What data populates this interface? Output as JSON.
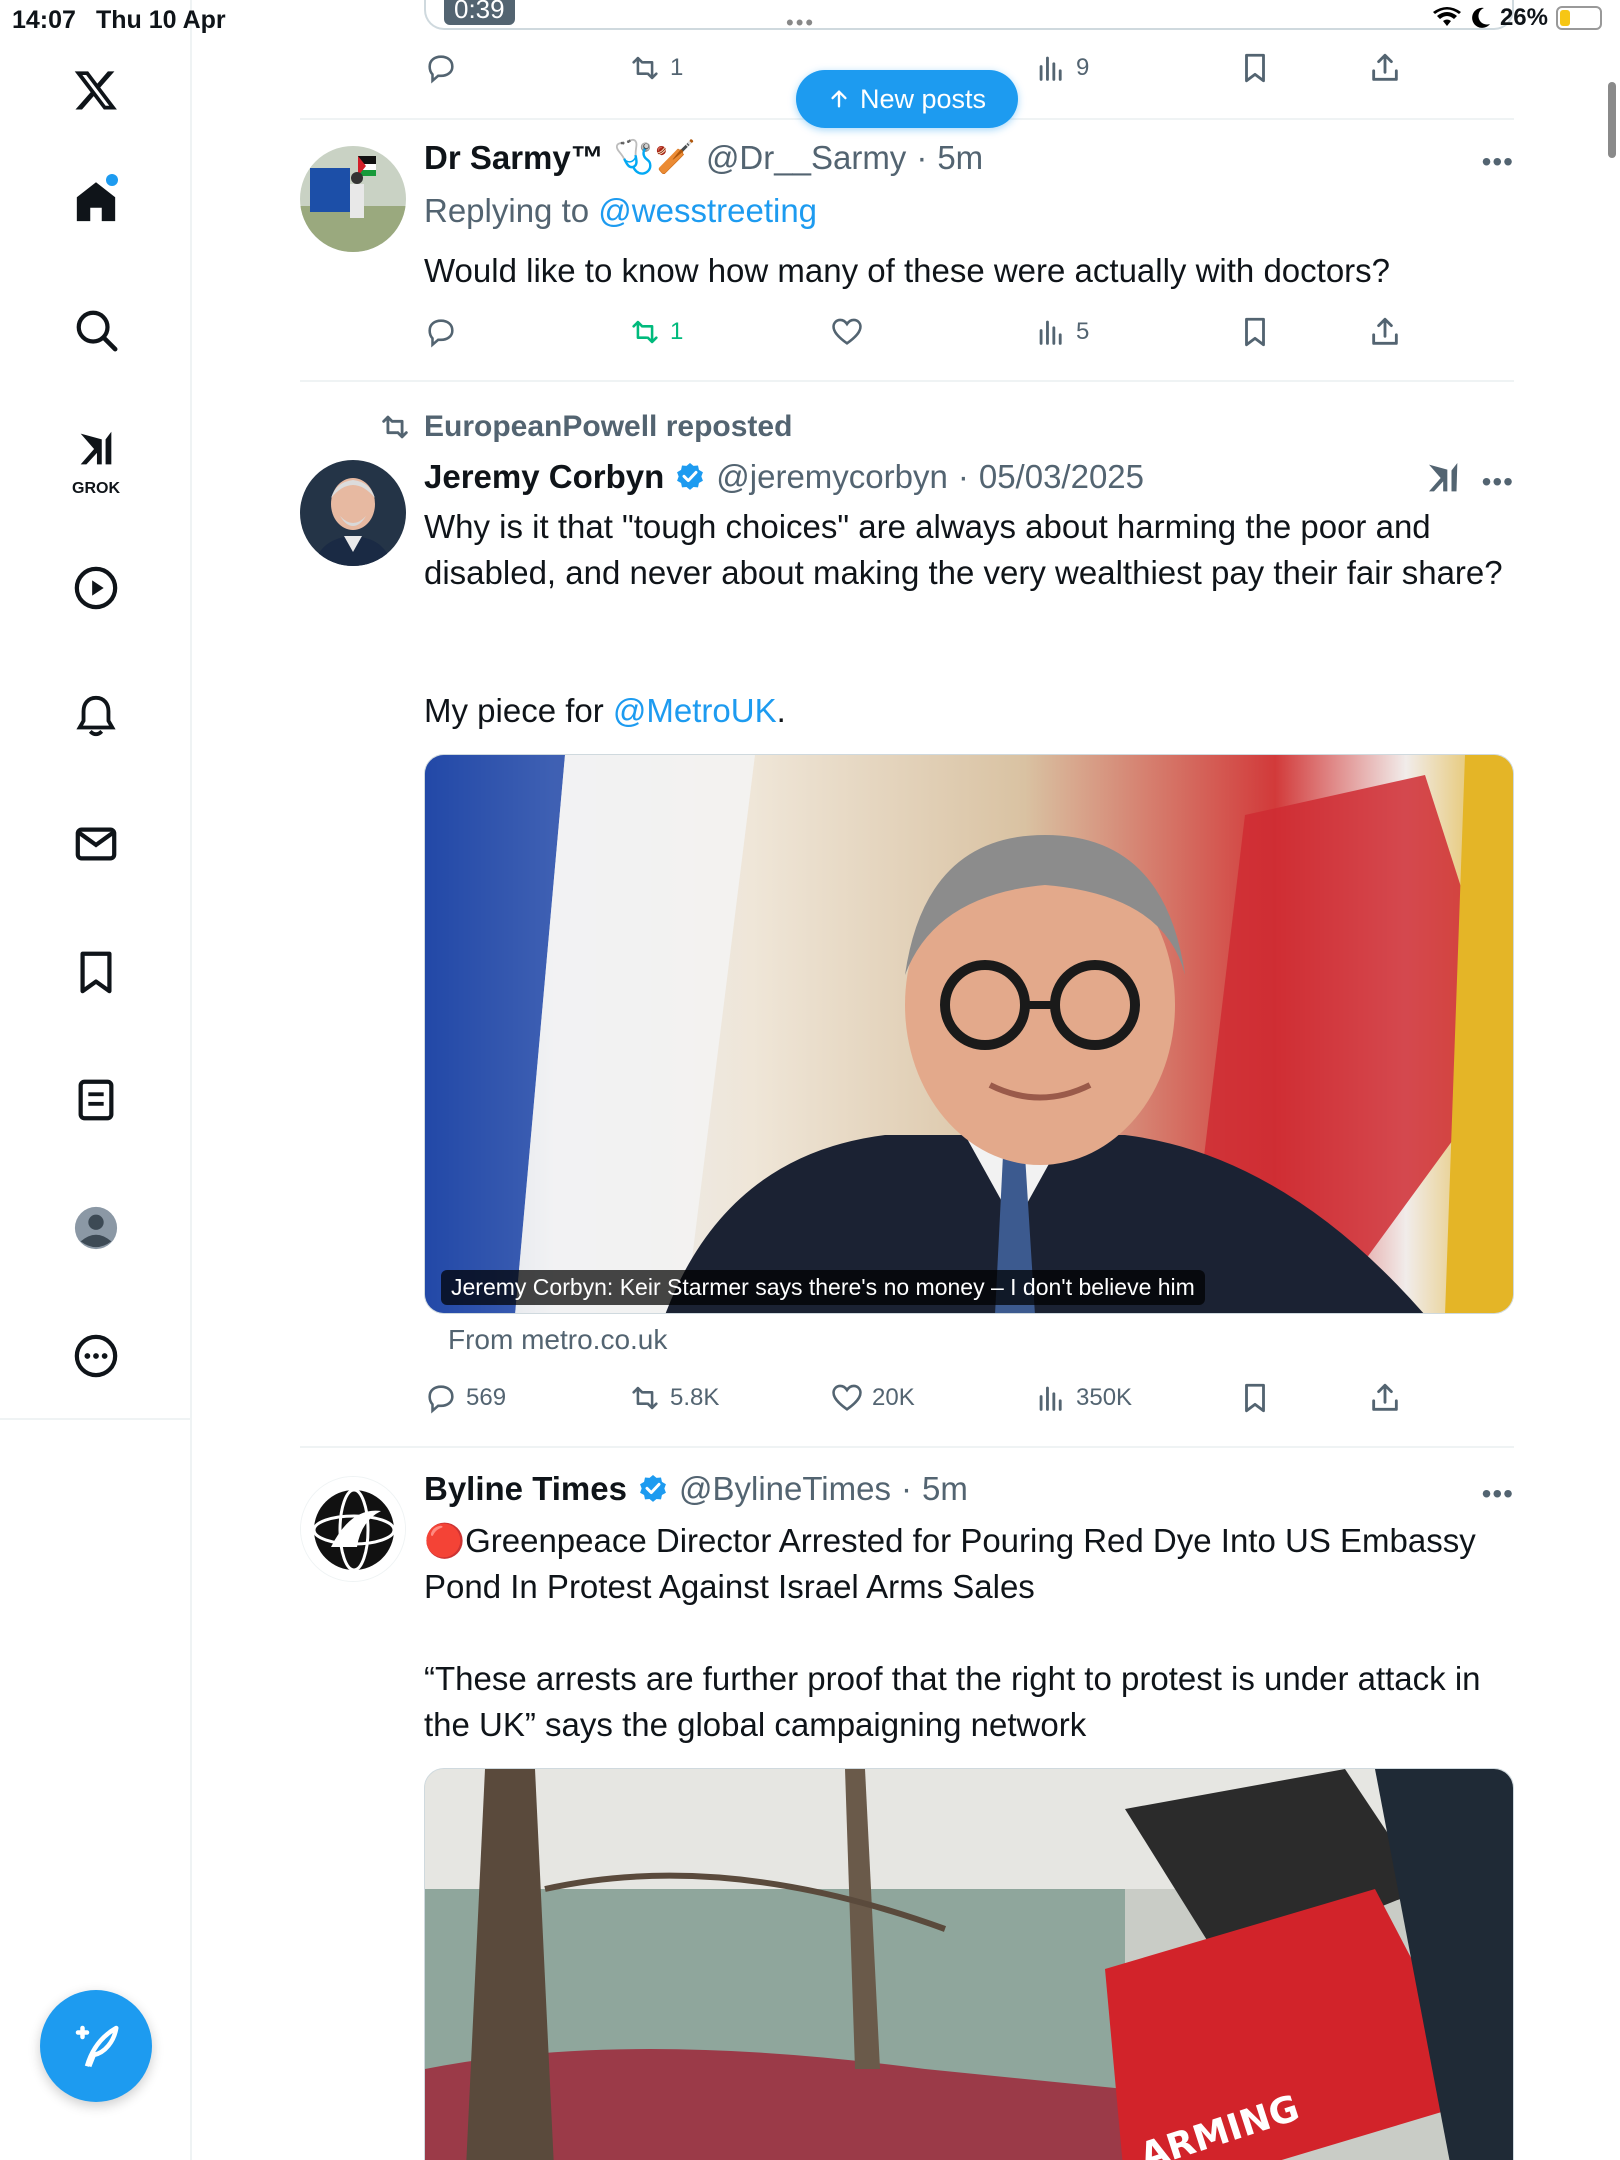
{
  "status_bar": {
    "time": "14:07",
    "date": "Thu 10 Apr",
    "battery": "26%",
    "dots": "•••"
  },
  "colors": {
    "accent": "#1d9bf0",
    "repost_green": "#00ba7c",
    "muted": "#536471"
  },
  "sidebar": {
    "items": [
      {
        "name": "logo",
        "icon": "x-logo-icon"
      },
      {
        "name": "home",
        "icon": "home-icon",
        "has_notification_dot": true
      },
      {
        "name": "explore",
        "icon": "search-icon"
      },
      {
        "name": "grok",
        "icon": "grok-icon",
        "label": "GROK"
      },
      {
        "name": "video",
        "icon": "play-icon"
      },
      {
        "name": "notifications",
        "icon": "bell-icon"
      },
      {
        "name": "messages",
        "icon": "mail-icon"
      },
      {
        "name": "bookmarks",
        "icon": "bookmark-icon"
      },
      {
        "name": "lists",
        "icon": "list-icon"
      },
      {
        "name": "profile",
        "icon": "avatar-icon"
      },
      {
        "name": "more",
        "icon": "more-circle-icon"
      }
    ],
    "compose_icon": "compose-icon"
  },
  "new_posts": {
    "label": "New posts"
  },
  "top_partial": {
    "video_time": "0:39",
    "retweets": "1",
    "views": "9"
  },
  "posts": [
    {
      "name": "Dr Sarmy™",
      "name_emoji": "🩺🏏",
      "handle": "@Dr__Sarmy",
      "time": "5m",
      "replying_prefix": "Replying to",
      "replying_to": "@wesstreeting",
      "text": "Would like to know how many of these were actually with doctors?",
      "stats": {
        "replies": "",
        "retweets": "1",
        "likes": "",
        "views": "5"
      }
    },
    {
      "repost_by": "EuropeanPowell reposted",
      "name": "Jeremy Corbyn",
      "handle": "@jeremycorbyn",
      "time": "05/03/2025",
      "text_1": "Why is it that \"tough choices\" are always about harming the poor and disabled, and never about making the very wealthiest pay their fair share?",
      "text_2_prefix": "My piece for",
      "text_2_link": "@MetroUK",
      "text_2_suffix": ".",
      "media_caption": "Jeremy Corbyn: Keir Starmer says there's no money – I don't believe him",
      "from_source": "From metro.co.uk",
      "stats": {
        "replies": "569",
        "retweets": "5.8K",
        "likes": "20K",
        "views": "350K"
      }
    },
    {
      "name": "Byline Times",
      "handle": "@BylineTimes",
      "time": "5m",
      "text_1": "🔴Greenpeace Director Arrested for Pouring Red Dye Into US Embassy Pond In Protest Against Israel Arms Sales",
      "text_2": "“These arrests are further proof that the right to protest is under attack in the UK” says the global campaigning network"
    }
  ]
}
